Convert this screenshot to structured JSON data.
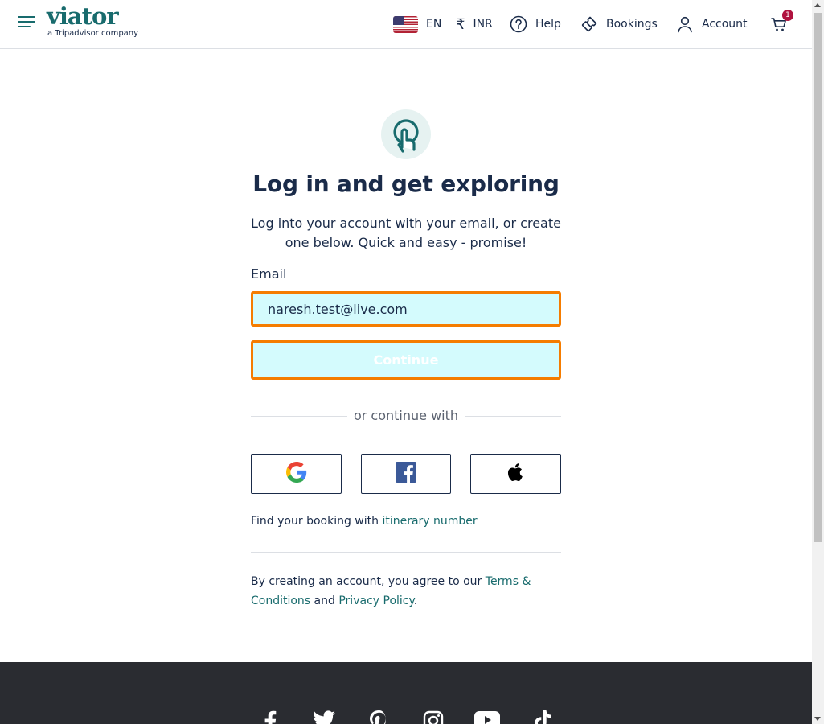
{
  "header": {
    "brand": "viator",
    "brand_sub": "a Tripadvisor company",
    "language": "EN",
    "currency": "INR",
    "help": "Help",
    "bookings": "Bookings",
    "account": "Account",
    "cart_count": "1"
  },
  "login": {
    "title": "Log in and get exploring",
    "subtitle": "Log into your account with your email, or create one below. Quick and easy - promise!",
    "email_label": "Email",
    "email_value": "naresh.test@live.com",
    "continue_label": "Continue",
    "divider_text": "or continue with",
    "social": [
      "google-icon",
      "facebook-icon",
      "apple-icon"
    ],
    "itinerary_prefix": "Find your booking with ",
    "itinerary_link": "itinerary number",
    "terms_prefix": "By creating an account, you agree to our ",
    "terms_link": "Terms & Conditions",
    "terms_and": " and ",
    "privacy_link": "Privacy Policy",
    "terms_suffix": "."
  },
  "footer": {
    "social_icons": [
      "facebook-icon",
      "twitter-icon",
      "pinterest-icon",
      "instagram-icon",
      "youtube-icon",
      "tiktok-icon"
    ]
  },
  "colors": {
    "brand": "#186b6d",
    "focus_border": "#f57c00",
    "input_bg": "#d4fbfd",
    "footer_bg": "#2a2c31",
    "badge": "#b0123f"
  }
}
